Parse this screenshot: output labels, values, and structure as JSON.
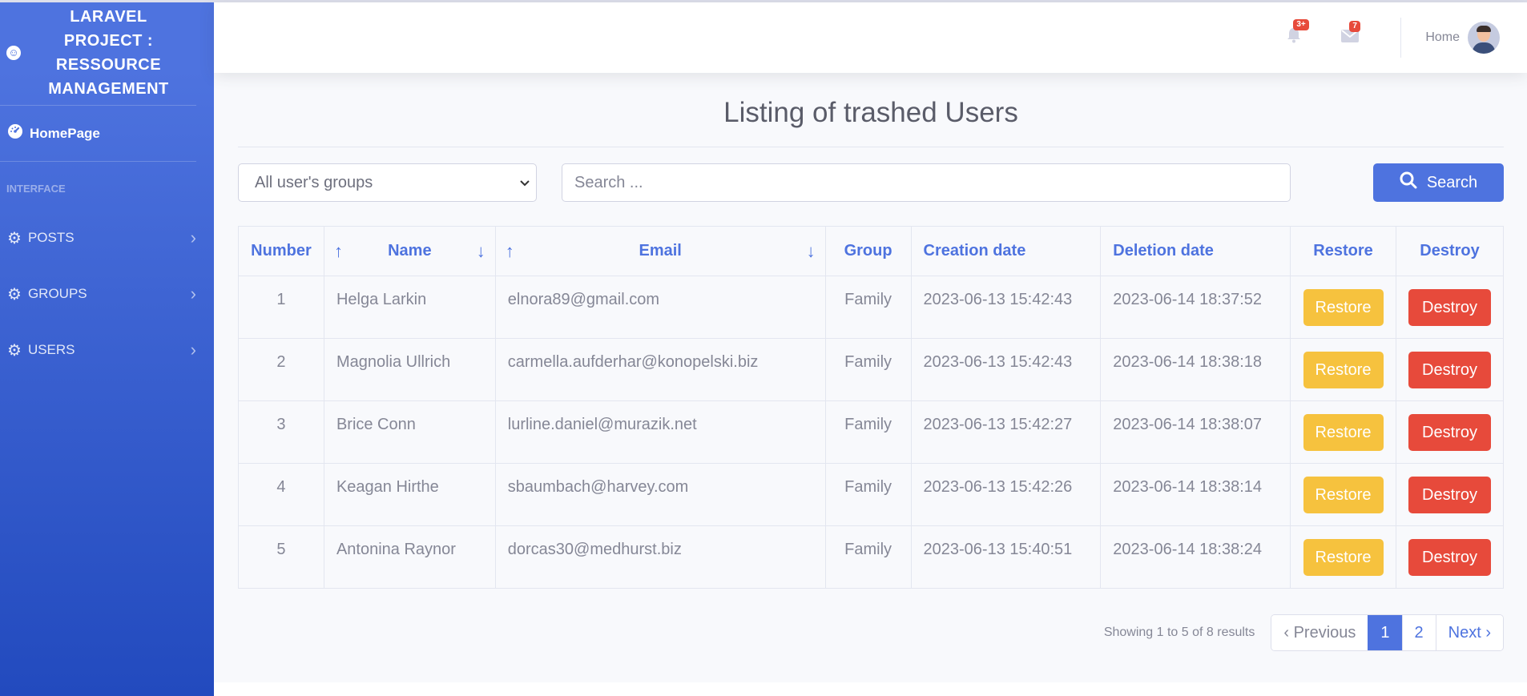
{
  "sidebar": {
    "brand_lines": [
      "LARAVEL",
      "PROJECT :",
      "RESSOURCE",
      "MANAGEMENT"
    ],
    "home_label": "HomePage",
    "section_heading": "INTERFACE",
    "items": [
      {
        "label": "POSTS",
        "icon": "gear-icon"
      },
      {
        "label": "GROUPS",
        "icon": "gear-icon"
      },
      {
        "label": "USERS",
        "icon": "gear-icon"
      }
    ]
  },
  "topbar": {
    "alerts_count": "3+",
    "messages_count": "7",
    "home_label": "Home"
  },
  "main": {
    "title": "Listing of trashed Users",
    "group_select": "All user's groups",
    "search_placeholder": "Search ...",
    "search_button": "Search"
  },
  "table": {
    "headers": {
      "number": "Number",
      "name": "Name",
      "email": "Email",
      "group": "Group",
      "creation": "Creation date",
      "deletion": "Deletion date",
      "restore": "Restore",
      "destroy": "Destroy"
    },
    "rows": [
      {
        "number": "1",
        "name": "Helga Larkin",
        "email": "elnora89@gmail.com",
        "group": "Family",
        "created": "2023-06-13 15:42:43",
        "deleted": "2023-06-14 18:37:52",
        "restore": "Restore",
        "destroy": "Destroy"
      },
      {
        "number": "2",
        "name": "Magnolia Ullrich",
        "email": "carmella.aufderhar@konopelski.biz",
        "group": "Family",
        "created": "2023-06-13 15:42:43",
        "deleted": "2023-06-14 18:38:18",
        "restore": "Restore",
        "destroy": "Destroy"
      },
      {
        "number": "3",
        "name": "Brice Conn",
        "email": "lurline.daniel@murazik.net",
        "group": "Family",
        "created": "2023-06-13 15:42:27",
        "deleted": "2023-06-14 18:38:07",
        "restore": "Restore",
        "destroy": "Destroy"
      },
      {
        "number": "4",
        "name": "Keagan Hirthe",
        "email": "sbaumbach@harvey.com",
        "group": "Family",
        "created": "2023-06-13 15:42:26",
        "deleted": "2023-06-14 18:38:14",
        "restore": "Restore",
        "destroy": "Destroy"
      },
      {
        "number": "5",
        "name": "Antonina Raynor",
        "email": "dorcas30@medhurst.biz",
        "group": "Family",
        "created": "2023-06-13 15:40:51",
        "deleted": "2023-06-14 18:38:24",
        "restore": "Restore",
        "destroy": "Destroy"
      }
    ]
  },
  "pagination": {
    "showing": "Showing 1 to 5 of 8 results",
    "previous": "‹ Previous",
    "pages": [
      "1",
      "2"
    ],
    "next": "Next ›"
  },
  "colors": {
    "primary": "#4e73df",
    "warning": "#f6c23e",
    "danger": "#e74a3b"
  }
}
